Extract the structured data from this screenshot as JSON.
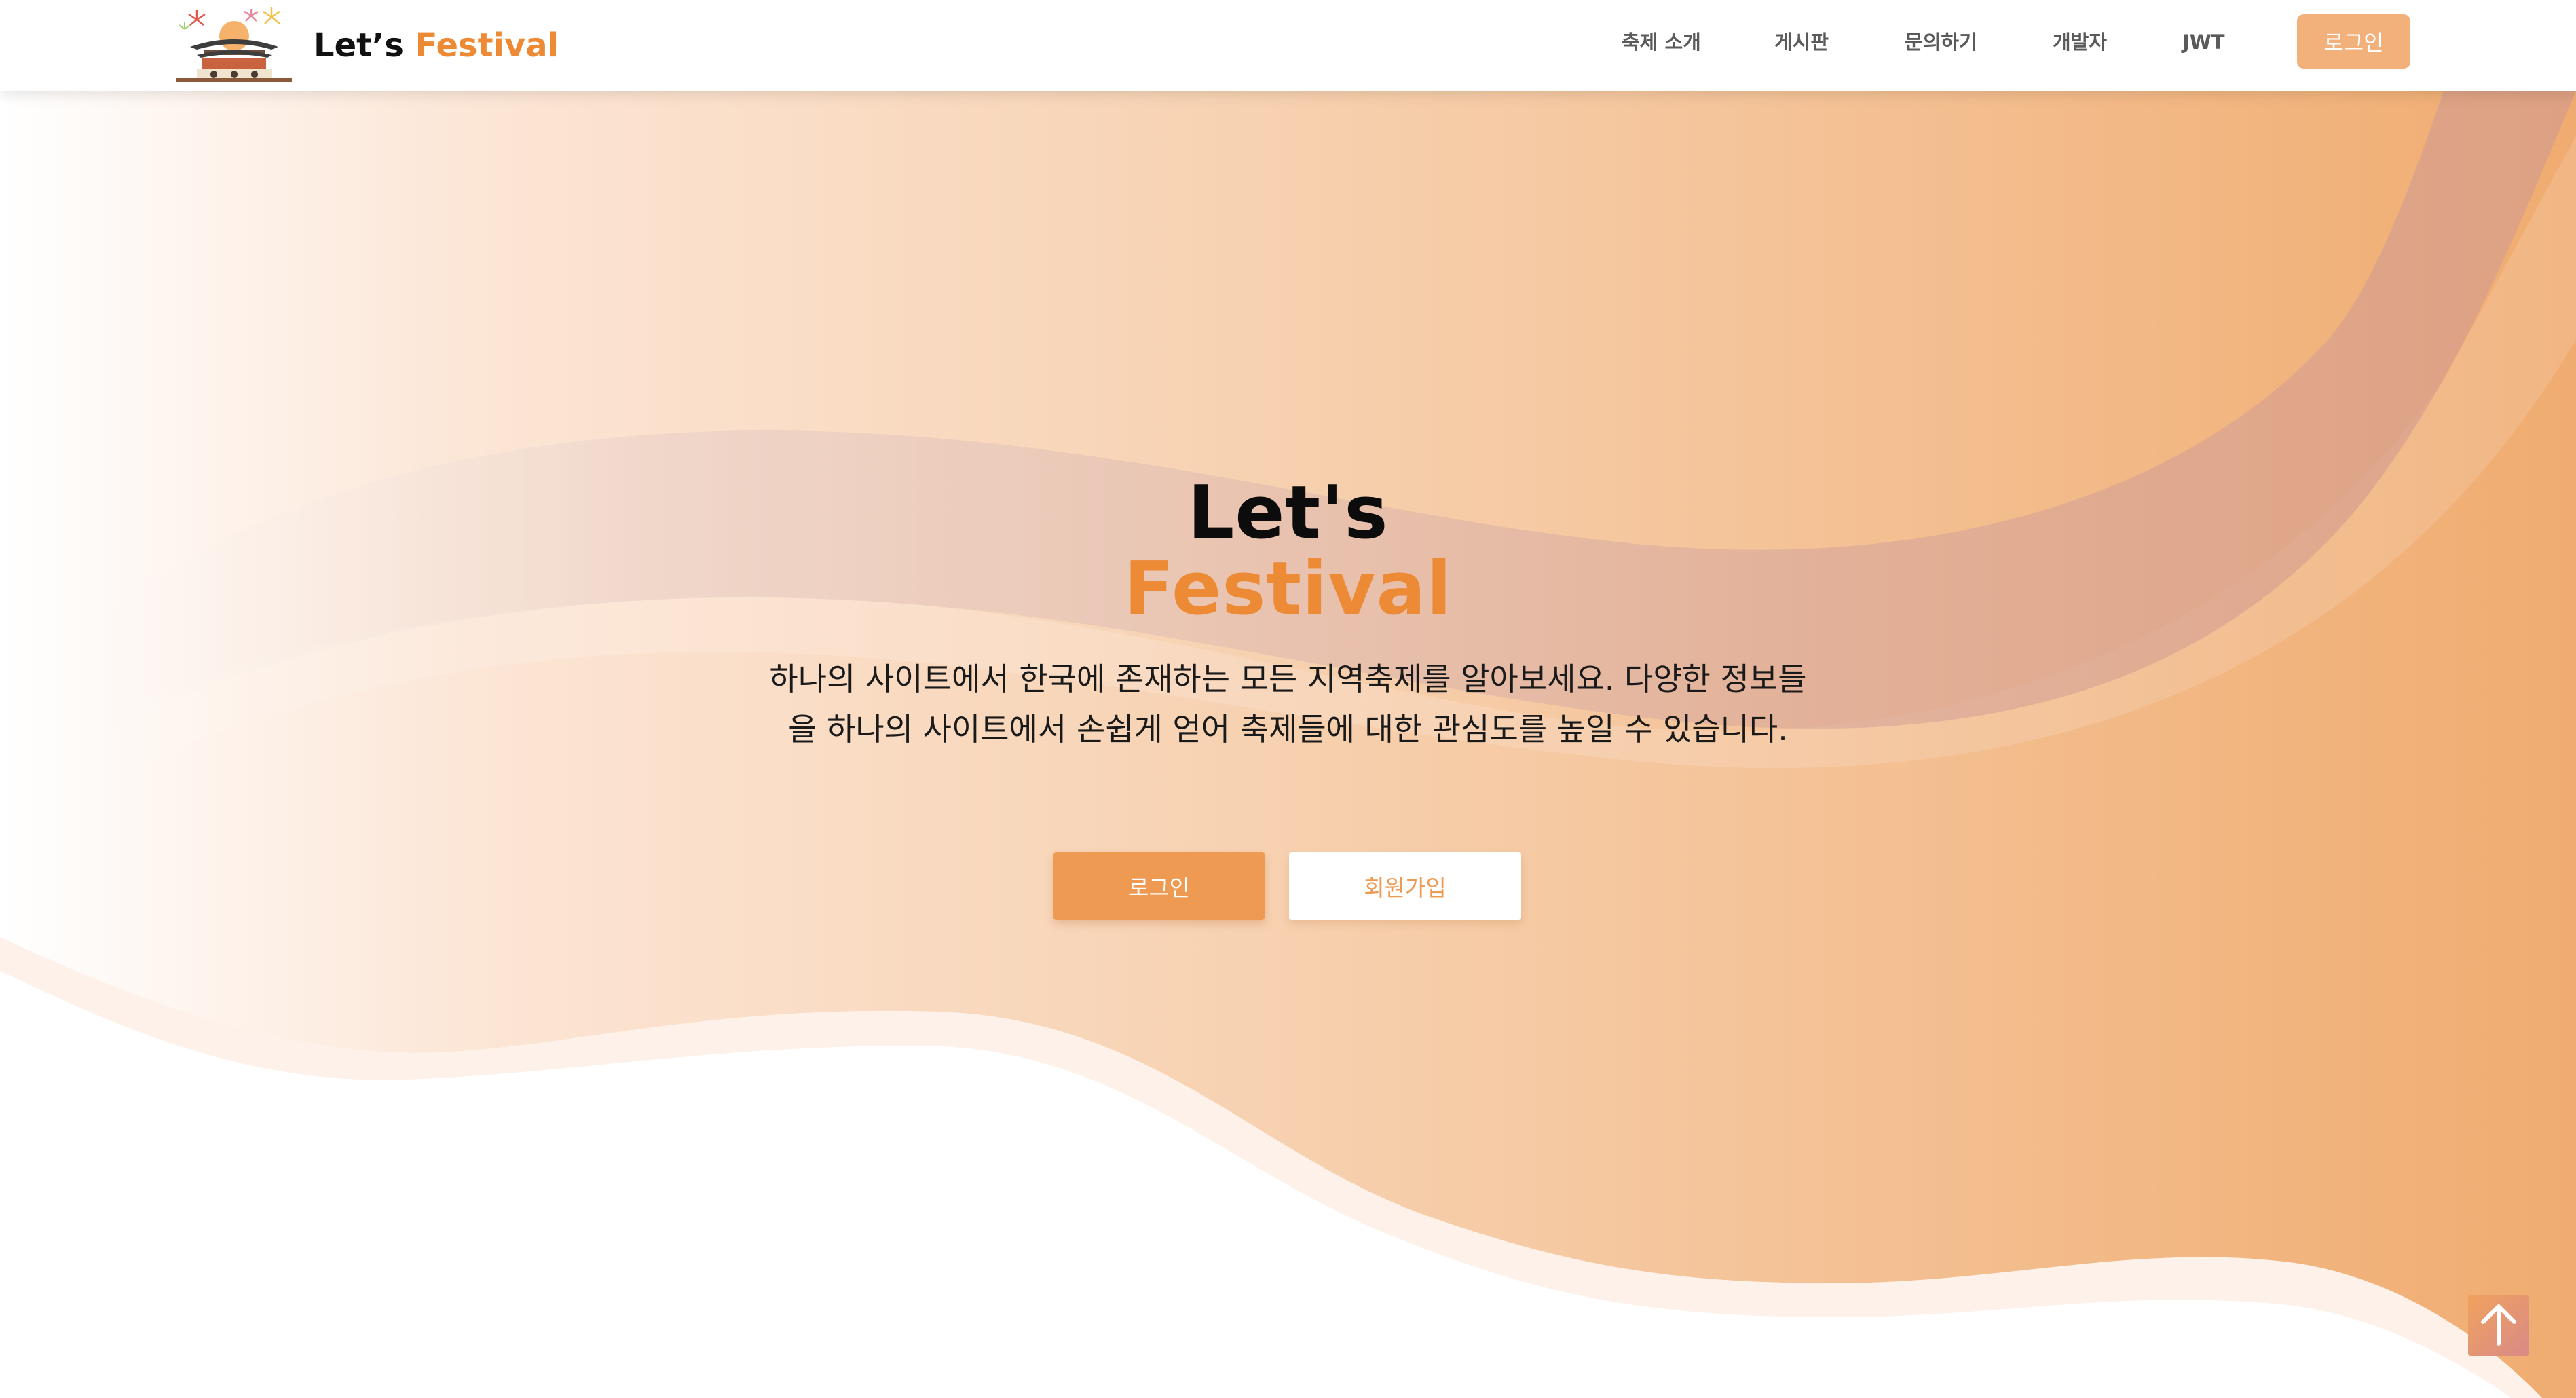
{
  "brand": {
    "name_prefix": "Let’s",
    "name_accent": "Festival",
    "logo_icon": "palace-fireworks-logo-icon"
  },
  "nav": {
    "links": [
      "축제 소개",
      "게시판",
      "문의하기",
      "개발자",
      "JWT"
    ],
    "login_label": "로그인"
  },
  "hero": {
    "title_line1": "Let's",
    "title_line2": "Festival",
    "description": "하나의 사이트에서 한국에 존재하는 모든 지역축제를 알아보세요. 다양한 정보들을 하나의 사이트에서 손쉽게 얻어 축제들에 대한 관심도를 높일 수 있습니다.",
    "login_button": "로그인",
    "signup_button": "회원가입"
  },
  "scroll_top": {
    "icon": "arrow-up-icon"
  },
  "colors": {
    "accent": "#ec8a35",
    "nav_button": "#f2b07a",
    "hero_button": "#ee9a52",
    "gradient_start": "#fff7f0",
    "gradient_end": "#f0ad72",
    "wave_band": "#d9a89a"
  }
}
